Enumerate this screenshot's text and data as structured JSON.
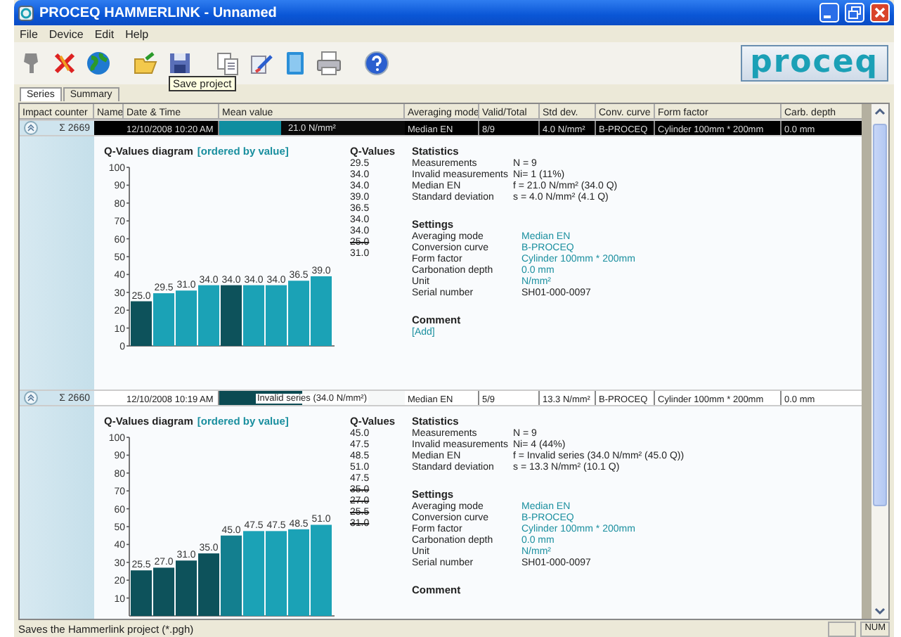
{
  "window": {
    "title": "PROCEQ HAMMERLINK - Unnamed"
  },
  "menu": [
    "File",
    "Device",
    "Edit",
    "Help"
  ],
  "toolbar": {
    "tooltip": "Save project",
    "logo": "proceq"
  },
  "tabs": [
    {
      "label": "Series",
      "selected": true
    },
    {
      "label": "Summary",
      "selected": false
    }
  ],
  "table": {
    "columns": [
      "Impact counter",
      "Name",
      "Date & Time",
      "Mean value",
      "Averaging mode",
      "Valid/Total",
      "Std dev.",
      "Conv. curve",
      "Form factor",
      "Carb. depth"
    ],
    "rows": [
      {
        "selected": true,
        "expanded": true,
        "sum_symbol": "Σ",
        "impact_counter": "2669",
        "date_time": "12/10/2008 10:20 AM",
        "mean": {
          "text": "21.0 N/mm²",
          "level": 0.33,
          "invalid": false
        },
        "averaging_mode": "Median EN",
        "valid_total": "8/9",
        "std_dev": "4.0 N/mm²",
        "conv_curve": "B-PROCEQ",
        "form_factor": "Cylinder 100mm * 200mm",
        "carb_depth": "0.0 mm",
        "details": {
          "chart": {
            "title": "Q-Values diagram",
            "order": "[ordered by value]",
            "chart_data": {
              "type": "bar",
              "ylim": [
                0,
                100
              ],
              "yticks": [
                0,
                10,
                20,
                30,
                40,
                50,
                60,
                70,
                80,
                90,
                100
              ],
              "value_labels": [
                "25.0",
                "29.5",
                "31.0",
                "34.0",
                "34.0",
                "34.0",
                "34.0",
                "36.5",
                "39.0"
              ],
              "series": [
                {
                  "color": "#0d525b",
                  "values": [
                    25.0,
                    null,
                    null,
                    null,
                    34.0,
                    null,
                    null,
                    null,
                    null
                  ]
                },
                {
                  "color": "#1ba2b6",
                  "values": [
                    null,
                    29.5,
                    31.0,
                    34.0,
                    null,
                    34.0,
                    34.0,
                    36.5,
                    39.0
                  ]
                }
              ]
            }
          },
          "q_values": {
            "heading": "Q-Values",
            "items": [
              {
                "value": "29.5",
                "invalid": false
              },
              {
                "value": "34.0",
                "invalid": false
              },
              {
                "value": "34.0",
                "invalid": false
              },
              {
                "value": "39.0",
                "invalid": false
              },
              {
                "value": "36.5",
                "invalid": false
              },
              {
                "value": "34.0",
                "invalid": false
              },
              {
                "value": "34.0",
                "invalid": false
              },
              {
                "value": "25.0",
                "invalid": true
              },
              {
                "value": "31.0",
                "invalid": false
              }
            ]
          },
          "statistics": {
            "heading": "Statistics",
            "rows": [
              {
                "label": "Measurements",
                "value": "N = 9"
              },
              {
                "label": "Invalid measurements",
                "value": "Ni= 1 (11%)"
              },
              {
                "label": "Median EN",
                "value": "f = 21.0 N/mm² (34.0 Q)"
              },
              {
                "label": "Standard deviation",
                "value": "s = 4.0 N/mm² (4.1 Q)"
              }
            ]
          },
          "settings": {
            "heading": "Settings",
            "rows": [
              {
                "label": "Averaging mode",
                "value": "Median EN",
                "accent": true
              },
              {
                "label": "Conversion curve",
                "value": "B-PROCEQ",
                "accent": true
              },
              {
                "label": "Form factor",
                "value": "Cylinder 100mm * 200mm",
                "accent": true
              },
              {
                "label": "Carbonation depth",
                "value": "0.0 mm",
                "accent": true
              },
              {
                "label": "Unit",
                "value": "N/mm²",
                "accent": true
              },
              {
                "label": "Serial number",
                "value": "SH01-000-0097",
                "accent": false
              }
            ]
          },
          "comment": {
            "heading": "Comment",
            "add": "[Add]"
          }
        }
      },
      {
        "selected": false,
        "expanded": true,
        "sum_symbol": "Σ",
        "impact_counter": "2660",
        "date_time": "12/10/2008 10:19 AM",
        "mean": {
          "text": "Invalid series (34.0 N/mm²)",
          "level": 0.45,
          "invalid": true
        },
        "averaging_mode": "Median EN",
        "valid_total": "5/9",
        "std_dev": "13.3 N/mm²",
        "conv_curve": "B-PROCEQ",
        "form_factor": "Cylinder 100mm * 200mm",
        "carb_depth": "0.0 mm",
        "details": {
          "chart": {
            "title": "Q-Values diagram",
            "order": "[ordered by value]",
            "chart_data": {
              "type": "bar",
              "ylim": [
                0,
                100
              ],
              "yticks": [
                10,
                20,
                30,
                40,
                50,
                60,
                70,
                80,
                90,
                100
              ],
              "value_labels": [
                "25.5",
                "27.0",
                "31.0",
                "35.0",
                "45.0",
                "47.5",
                "47.5",
                "48.5",
                "51.0"
              ],
              "series": [
                {
                  "color": "#0d525b",
                  "values": [
                    25.5,
                    27.0,
                    31.0,
                    35.0,
                    null,
                    null,
                    null,
                    null,
                    null
                  ]
                },
                {
                  "color": "#137f8f",
                  "values": [
                    null,
                    null,
                    null,
                    null,
                    45.0,
                    null,
                    null,
                    null,
                    null
                  ]
                },
                {
                  "color": "#1ba2b6",
                  "values": [
                    null,
                    null,
                    null,
                    null,
                    null,
                    47.5,
                    47.5,
                    48.5,
                    51.0
                  ]
                }
              ]
            }
          },
          "q_values": {
            "heading": "Q-Values",
            "items": [
              {
                "value": "45.0",
                "invalid": false
              },
              {
                "value": "47.5",
                "invalid": false
              },
              {
                "value": "48.5",
                "invalid": false
              },
              {
                "value": "51.0",
                "invalid": false
              },
              {
                "value": "47.5",
                "invalid": false
              },
              {
                "value": "35.0",
                "invalid": true
              },
              {
                "value": "27.0",
                "invalid": true
              },
              {
                "value": "25.5",
                "invalid": true
              },
              {
                "value": "31.0",
                "invalid": true
              }
            ]
          },
          "statistics": {
            "heading": "Statistics",
            "rows": [
              {
                "label": "Measurements",
                "value": "N = 9"
              },
              {
                "label": "Invalid measurements",
                "value": "Ni= 4 (44%)"
              },
              {
                "label": "Median EN",
                "value": "f = Invalid series (34.0 N/mm² (45.0 Q))"
              },
              {
                "label": "Standard deviation",
                "value": "s = 13.3 N/mm² (10.1 Q)"
              }
            ]
          },
          "settings": {
            "heading": "Settings",
            "rows": [
              {
                "label": "Averaging mode",
                "value": "Median EN",
                "accent": true
              },
              {
                "label": "Conversion curve",
                "value": "B-PROCEQ",
                "accent": true
              },
              {
                "label": "Form factor",
                "value": "Cylinder 100mm * 200mm",
                "accent": true
              },
              {
                "label": "Carbonation depth",
                "value": "0.0 mm",
                "accent": true
              },
              {
                "label": "Unit",
                "value": "N/mm²",
                "accent": true
              },
              {
                "label": "Serial number",
                "value": "SH01-000-0097",
                "accent": false
              }
            ]
          },
          "comment": {
            "heading": "Comment"
          }
        }
      }
    ]
  },
  "status_bar": {
    "message": "Saves the Hammerlink project (*.pgh)",
    "indicator": "NUM"
  }
}
